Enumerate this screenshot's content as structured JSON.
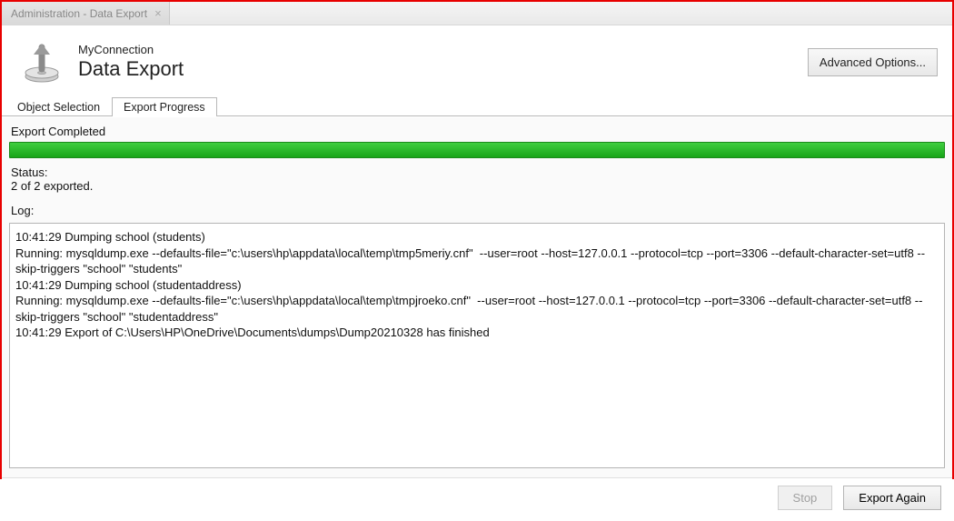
{
  "app_tab": {
    "label": "Administration - Data Export"
  },
  "header": {
    "connection_name": "MyConnection",
    "page_title": "Data Export",
    "advanced_button": "Advanced Options..."
  },
  "sub_tabs": {
    "items": [
      "Object Selection",
      "Export Progress"
    ],
    "active_index": 1
  },
  "progress": {
    "heading": "Export Completed",
    "status_label": "Status:",
    "status_value": "2 of 2 exported."
  },
  "log": {
    "label": "Log:",
    "text": "10:41:29 Dumping school (students)\nRunning: mysqldump.exe --defaults-file=\"c:\\users\\hp\\appdata\\local\\temp\\tmp5meriy.cnf\"  --user=root --host=127.0.0.1 --protocol=tcp --port=3306 --default-character-set=utf8 --skip-triggers \"school\" \"students\"\n10:41:29 Dumping school (studentaddress)\nRunning: mysqldump.exe --defaults-file=\"c:\\users\\hp\\appdata\\local\\temp\\tmpjroeko.cnf\"  --user=root --host=127.0.0.1 --protocol=tcp --port=3306 --default-character-set=utf8 --skip-triggers \"school\" \"studentaddress\"\n10:41:29 Export of C:\\Users\\HP\\OneDrive\\Documents\\dumps\\Dump20210328 has finished"
  },
  "footer": {
    "stop_label": "Stop",
    "export_again_label": "Export Again"
  }
}
